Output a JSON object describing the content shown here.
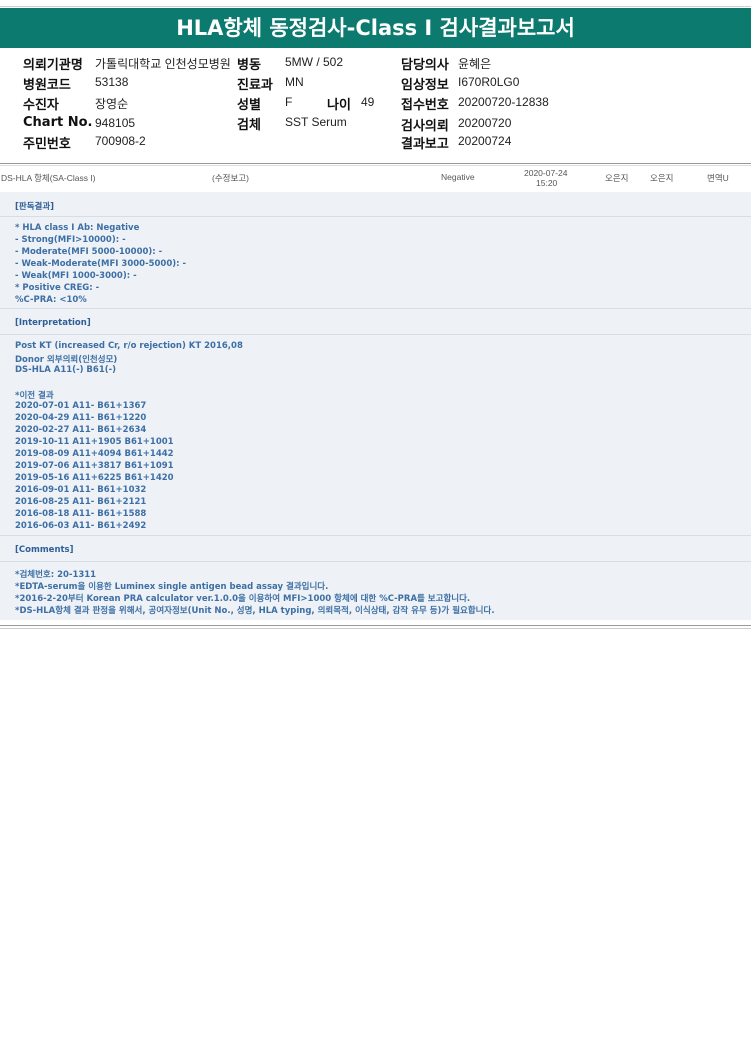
{
  "title": "HLA항체 동정검사-Class I 검사결과보고서",
  "info": {
    "requesting_org_label": "의뢰기관명",
    "requesting_org_value": "가톨릭대학교 인천성모병원",
    "ward_label": "병동",
    "ward_value": "5MW / 502",
    "doctor_label": "담당의사",
    "doctor_value": "윤혜은",
    "hospital_code_label": "병원코드",
    "hospital_code_value": "53138",
    "dept_label": "진료과",
    "dept_value": "MN",
    "clinical_info_label": "임상정보",
    "clinical_info_value": "I670R0LG0",
    "patient_label": "수진자",
    "patient_value": "장영순",
    "sex_label": "성별",
    "sex_value": "F",
    "age_label": "나이",
    "age_value": "49",
    "receipt_no_label": "접수번호",
    "receipt_no_value": "20200720-12838",
    "chart_no_label": "Chart No.",
    "chart_no_value": "948105",
    "specimen_label": "검체",
    "specimen_value": "SST Serum",
    "request_date_label": "검사의뢰",
    "request_date_value": "20200720",
    "resident_no_label": "주민번호",
    "resident_no_value": "700908-2",
    "report_date_label": "결과보고",
    "report_date_value": "20200724"
  },
  "result_row": {
    "test_name": "DS-HLA 항체(SA-Class I)",
    "note": "(수정보고)",
    "result": "Negative",
    "date": "2020-07-24",
    "time": "15:20",
    "person1": "오은지",
    "person2": "오은지",
    "reviewer": "변역U"
  },
  "panel": {
    "judgment_header": "[판독결과]",
    "judgment_lines": [
      "* HLA class I Ab: Negative",
      "- Strong(MFI>10000): -",
      "- Moderate(MFI 5000-10000): -",
      "- Weak-Moderate(MFI 3000-5000): -",
      "- Weak(MFI 1000-3000): -",
      "* Positive CREG: -",
      " %C-PRA: <10%"
    ],
    "interpretation_header": "[Interpretation]",
    "interpretation_lines": [
      "Post KT (increased Cr, r/o rejection) KT 2016,08",
      "Donor 외부의뢰(인천성모)",
      "DS-HLA A11(-) B61(-)",
      "",
      "*이전 결과",
      "2020-07-01 A11- B61+1367",
      "2020-04-29 A11- B61+1220",
      "2020-02-27 A11- B61+2634",
      "2019-10-11 A11+1905 B61+1001",
      "2019-08-09 A11+4094 B61+1442",
      "2019-07-06 A11+3817 B61+1091",
      "2019-05-16 A11+6225 B61+1420",
      "2016-09-01 A11- B61+1032",
      "2016-08-25 A11- B61+2121",
      "2016-08-18 A11- B61+1588",
      "2016-06-03 A11- B61+2492"
    ],
    "comments_header": "[Comments]",
    "comments_lines": [
      "*검체번호: 20-1311",
      "*EDTA-serum을 이용한 Luminex single antigen bead assay 결과입니다.",
      "*2016-2-20부터 Korean PRA calculator ver.1.0.0을 이용하여 MFI>1000 항체에 대한 %C-PRA를 보고합니다.",
      "*DS-HLA항체 결과 판정을 위해서, 공여자정보(Unit No., 성명, HLA typing, 의뢰목적, 이식상태, 감작 유무 등)가 필요합니다."
    ]
  }
}
